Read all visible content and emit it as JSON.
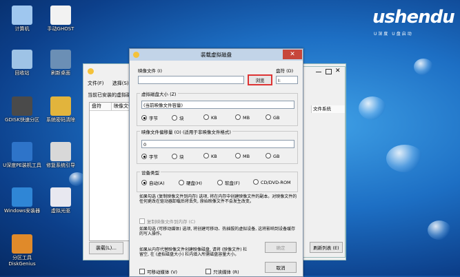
{
  "desktop": {
    "icons": [
      {
        "label": "计算机",
        "icon": "computer-icon",
        "color": "#9fc7ef"
      },
      {
        "label": "手动GHOST",
        "icon": "ghost-icon",
        "color": "#f2f2f2"
      },
      {
        "label": "回收站",
        "icon": "recycle-bin-icon",
        "color": "#9ec3e6"
      },
      {
        "label": "刷新桌面",
        "icon": "monitor-icon",
        "color": "#6b8fb5"
      },
      {
        "label": "GDISK快速分区",
        "icon": "gdisk-icon",
        "color": "#4a4a4a"
      },
      {
        "label": "系统密码清除",
        "icon": "key-icon",
        "color": "#e2b43c"
      },
      {
        "label": "U深度PE装机工具",
        "icon": "pe-install-icon",
        "color": "#2e74c9"
      },
      {
        "label": "修复系统引导",
        "icon": "repair-boot-icon",
        "color": "#d8d8d8"
      },
      {
        "label": "Windows安装器",
        "icon": "windows-installer-icon",
        "color": "#2f86d6"
      },
      {
        "label": "虚拟光驱",
        "icon": "virtual-drive-icon",
        "color": "#e8e8f0"
      },
      {
        "label": "分区工具DiskGenius",
        "icon": "diskgenius-icon",
        "color": "#e08a2a"
      }
    ],
    "logo": {
      "main": "ushendu",
      "sub": "U深度 U盘启动"
    }
  },
  "bg_window": {
    "menu": [
      "文件(F)",
      "选择(S)"
    ],
    "heading": "当前已安装的虚拟磁盘",
    "columns": [
      "盘符",
      "映像文件",
      "文件系统"
    ],
    "load_button": "装载(L)..."
  },
  "dialog": {
    "title": "装载虚拟磁盘",
    "close_glyph": "✕",
    "image_file_label": "映像文件 (I)",
    "image_file_value": "",
    "browse_button": "浏览",
    "drive_letter_label": "盘符 (D)",
    "drive_letter_value": "I:",
    "size_group": "虚拟磁盘大小 (Z)",
    "size_value": "(当前映像文件容量)",
    "size_units": [
      "字节",
      "块",
      "KB",
      "MB",
      "GB"
    ],
    "size_unit_selected": 0,
    "offset_group": "映像文件偏移量 (O) (适用于非映像文件格式)",
    "offset_value": "0",
    "offset_units": [
      "字节",
      "块",
      "KB",
      "MB",
      "GB"
    ],
    "offset_unit_selected": 0,
    "device_group": "设备类型",
    "device_types": [
      "自动(A)",
      "硬盘(H)",
      "软盘(F)",
      "CD/DVD-ROM"
    ],
    "device_selected": 0,
    "copy_note": "如果勾选 (复制映像文件到内存) 选项, 将在内存中创建映像文件的副本。对映像文件的任何更改在驱动器卸载后将丢失, 原始映像文件不会发生改变。",
    "copy_checkbox": "复制映像文件到内存 (C)",
    "removable_note": "如果勾选 (可移动媒体) 选项, 将创建可移动、热插拔的虚拟设备, 这将影响到设备缓存的写入操作。",
    "removable_checkbox": "可移动媒体 (V)",
    "readonly_checkbox": "只读媒体 (R)",
    "memory_note": "如果从内存代替映像文件创建映像磁盘, 请将 (映像文件) 栏留空, 在 (虚拟磁盘大小) 栏内填入所需磁盘容量大小。",
    "ok_button": "确定",
    "cancel_button": "取消"
  },
  "bg_right": {
    "refresh_button": "刷新列表 (E)"
  }
}
